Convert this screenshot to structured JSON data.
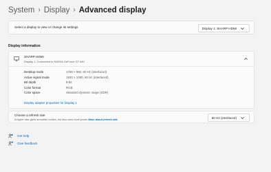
{
  "breadcrumb": {
    "items": [
      "System",
      "Display",
      "Advanced display"
    ],
    "separator": "›"
  },
  "select_display": {
    "label": "Select a display to view or change its settings",
    "value": "Display 1: SHARP HDMI"
  },
  "display_info": {
    "section_title": "Display information",
    "name": "SHARP HDMI",
    "subtitle": "Display 1: Connected to NVIDIA GeForce GT 640",
    "properties": [
      {
        "label": "Desktop mode",
        "value": "1768 × 992, 60 Hz (interlaced)"
      },
      {
        "label": "Active signal mode",
        "value": "1920 × 1080, 60 Hz (interlaced)"
      },
      {
        "label": "Bit depth",
        "value": "8-bit"
      },
      {
        "label": "Color format",
        "value": "RGB"
      },
      {
        "label": "Color space",
        "value": "Standard dynamic range (SDR)"
      }
    ],
    "adapter_link": "Display adapter properties for Display 1"
  },
  "refresh_rate": {
    "title": "Choose a refresh rate",
    "description": "A higher rate gives smoother motion, but also uses more power",
    "more_link": "More about refresh rate",
    "value": "60 Hz (interlaced)"
  },
  "help": {
    "get_help": "Get help",
    "give_feedback": "Give feedback"
  },
  "colors": {
    "background": "#f3f3f3",
    "card": "#fbfbfb",
    "accent_link": "#0067c0"
  }
}
